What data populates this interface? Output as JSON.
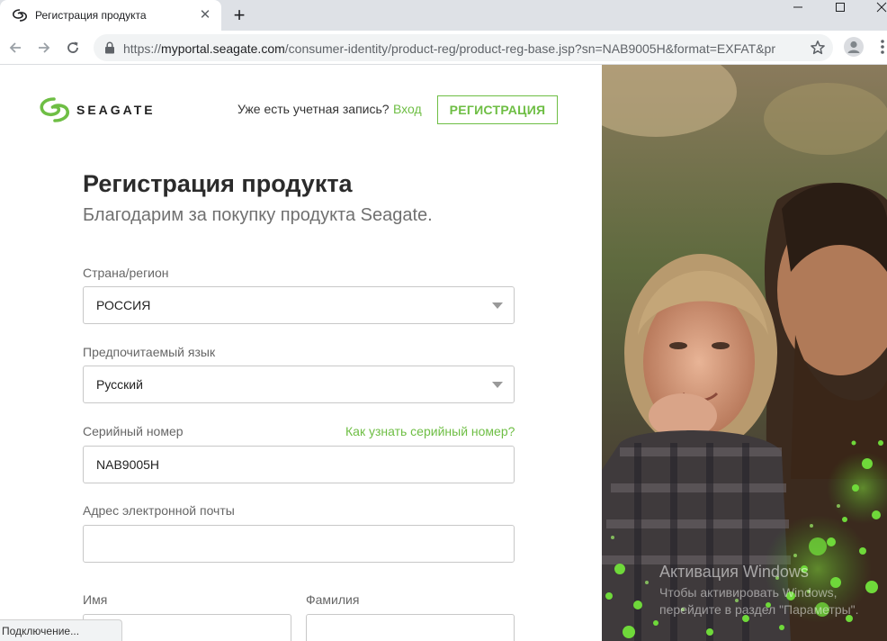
{
  "browser": {
    "tab_title": "Регистрация продукта",
    "url_prefix": "https://",
    "url_host": "myportal.seagate.com",
    "url_path": "/consumer-identity/product-reg/product-reg-base.jsp?sn=NAB9005H&format=EXFAT&pr...",
    "status": "Подключение..."
  },
  "header": {
    "logo_text": "SEAGATE",
    "have_account": "Уже есть учетная запись?",
    "login": "Вход",
    "register": "РЕГИСТРАЦИЯ"
  },
  "form": {
    "title": "Регистрация продукта",
    "subtitle": "Благодарим за покупку продукта Seagate.",
    "country_label": "Страна/регион",
    "country_value": "РОССИЯ",
    "language_label": "Предпочитаемый язык",
    "language_value": "Русский",
    "serial_label": "Серийный номер",
    "serial_help": "Как узнать серийный номер?",
    "serial_value": "NAB9005H",
    "email_label": "Адрес электронной почты",
    "email_value": "",
    "first_name_label": "Имя",
    "last_name_label": "Фамилия"
  },
  "watermark": {
    "title": "Активация Windows",
    "line1": "Чтобы активировать Windows,",
    "line2": "перейдите в раздел \"Параметры\"."
  },
  "colors": {
    "accent": "#6ebe44",
    "text": "#2b2b2b",
    "muted": "#707070"
  }
}
